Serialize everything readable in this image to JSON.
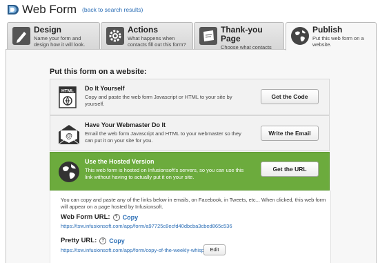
{
  "header": {
    "title": "Web Form",
    "back_link": "(back to search results)"
  },
  "tabs": [
    {
      "title": "Design",
      "desc": "Name your form and design how it will look.",
      "icon": "pencil-icon"
    },
    {
      "title": "Actions",
      "desc": "What happens when contacts fill out this form?",
      "icon": "gear-icon"
    },
    {
      "title": "Thank-you Page",
      "desc": "Choose what contacts see after they fill out this form.",
      "icon": "thanks-note-icon"
    },
    {
      "title": "Publish",
      "desc": "Put this web form on a website.",
      "icon": "globe-icon"
    }
  ],
  "section_title": "Put this form on a website:",
  "options": [
    {
      "title": "Do It Yourself",
      "desc": "Copy and paste the web form Javascript or HTML to your site by yourself.",
      "button": "Get the Code",
      "icon": "html-code-icon",
      "icon_label": "HTML"
    },
    {
      "title": "Have Your Webmaster Do It",
      "desc": "Email the web form Javascript and HTML to your webmaster so they can put it on your site for you.",
      "button": "Write the Email",
      "icon": "email-icon"
    },
    {
      "title": "Use the Hosted Version",
      "desc": "This web form is hosted on Infusionsoft's servers, so you can use this link without having to actually put it on your site.",
      "button": "Get the URL",
      "icon": "globe-icon"
    }
  ],
  "hosted": {
    "info": "You can copy and paste any of the links below in emails, on Facebook, in Tweets, etc... When clicked, this web form will appear on a page hosted by Infusionsoft.",
    "web_form_url_label": "Web Form URL:",
    "web_form_url": "https://tsw.infusionsoft.com/app/form/a97725c8ecfd40dbcba3cbed865c536",
    "pretty_url_label": "Pretty URL:",
    "pretty_url": "https://tsw.infusionsoft.com/app/form/copy-of-the-weekly-whisper",
    "copy_label": "Copy",
    "help_glyph": "?",
    "edit_label": "Edit"
  },
  "colors": {
    "accent_green": "#6cab3d",
    "link_blue": "#2a6db5"
  }
}
